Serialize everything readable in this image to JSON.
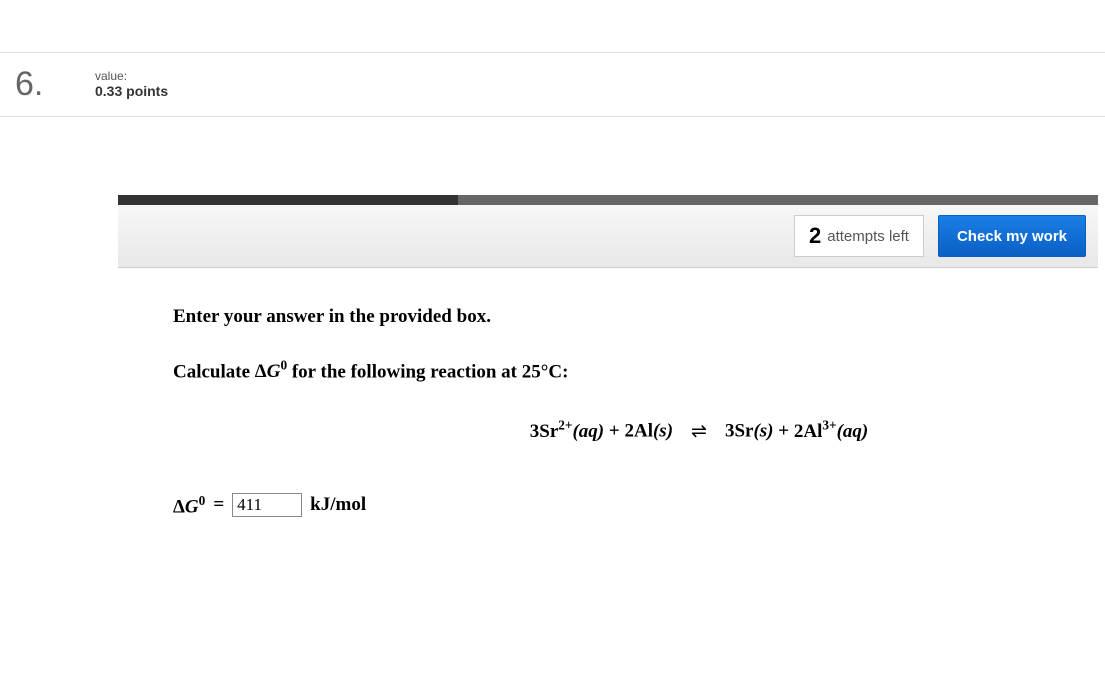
{
  "question": {
    "number": "6.",
    "value_label": "value:",
    "points": "0.33 points"
  },
  "toolbar": {
    "attempts_count": "2",
    "attempts_text": "attempts left",
    "check_label": "Check my work"
  },
  "body": {
    "instruction": "Enter your answer in the provided box.",
    "calc_prefix": "Calculate ",
    "calc_suffix": " for the following reaction at 25°C:",
    "delta": "Δ",
    "g": "G",
    "deg": "0",
    "reaction": {
      "lhs_coef1": "3Sr",
      "lhs_sup1": "2+",
      "lhs_state1": "(aq)",
      "plus": " + ",
      "lhs_coef2": "2Al",
      "lhs_state2": "(s)",
      "arrow": "⇌",
      "rhs_coef1": "3Sr",
      "rhs_state1": "(s)",
      "rhs_coef2": "2Al",
      "rhs_sup2": "3+",
      "rhs_state2": "(aq)"
    },
    "equals": " = ",
    "answer_value": "411",
    "unit": "kJ/mol"
  }
}
